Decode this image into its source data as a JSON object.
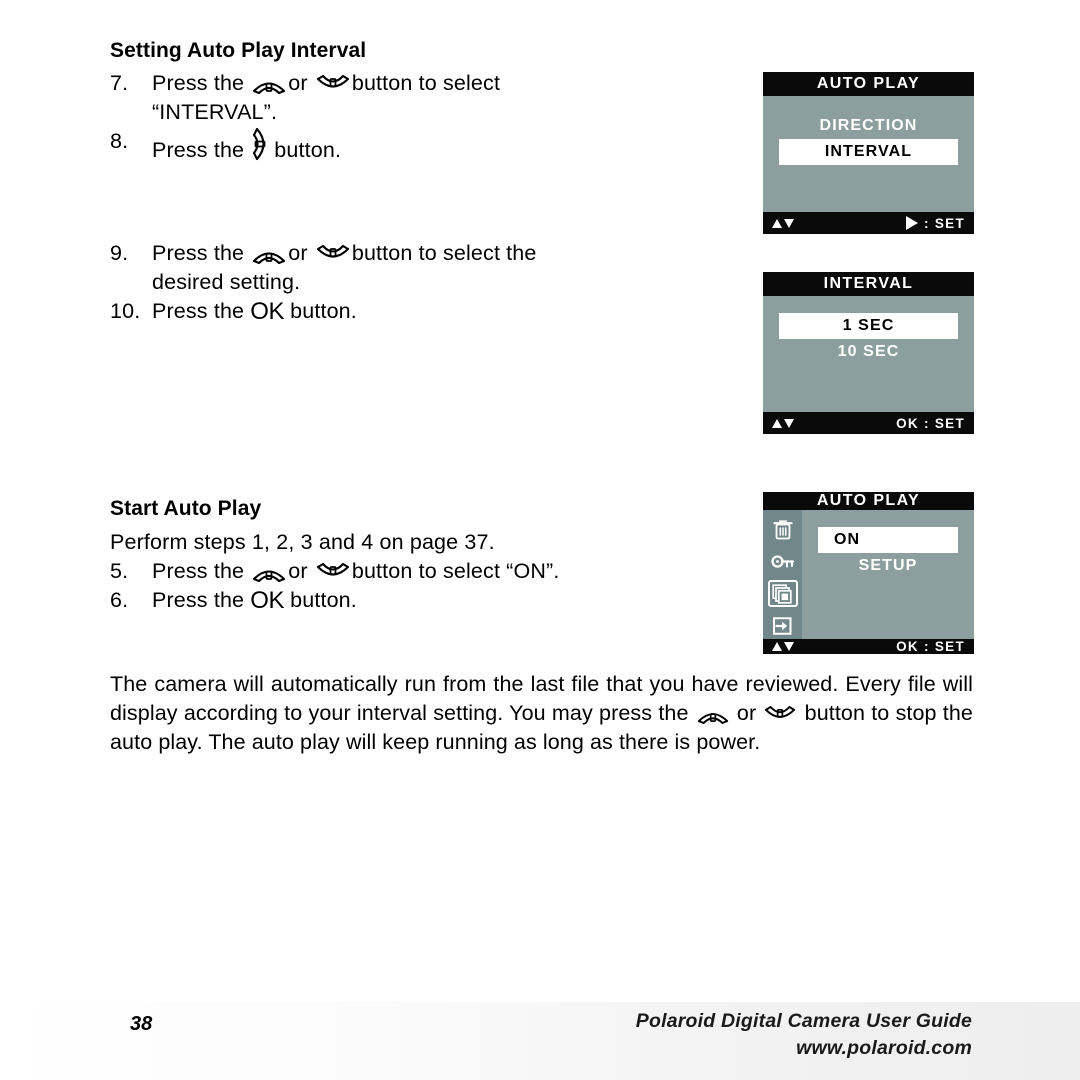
{
  "document": {
    "page_number": "38",
    "footer_title": "Polaroid Digital Camera User Guide",
    "footer_url": "www.polaroid.com"
  },
  "sections": [
    {
      "heading": "Setting Auto Play Interval",
      "steps": [
        {
          "number": "7.",
          "parts": [
            "Press the ",
            "[up-button-icon]",
            " or ",
            "[down-button-icon]",
            " button to select"
          ],
          "text_before_icons": "Press the",
          "text_between_icons": "or",
          "text_after_icons": "button to select",
          "continuation": "“INTERVAL”."
        },
        {
          "number": "8.",
          "text_before_icons": "Press the",
          "icon": "[right-button-icon]",
          "text_after_icons": "button."
        }
      ]
    },
    {
      "heading": "",
      "steps": [
        {
          "number": "9.",
          "text_before_icons": "Press the",
          "text_between_icons": "or",
          "text_after_icons": "button to select the",
          "continuation": "desired setting."
        },
        {
          "number": "10.",
          "text_before_icons": "Press the",
          "icon": "[ok-button-glyph]",
          "ok_label": "OK",
          "text_after_icons": "button."
        }
      ]
    },
    {
      "heading": "Start Auto Play",
      "intro": "Perform steps 1, 2, 3 and 4 on page 37.",
      "steps": [
        {
          "number": "5.",
          "text_before_icons": "Press the",
          "text_between_icons": "or",
          "text_after_icons": "button to select “ON”."
        },
        {
          "number": "6.",
          "text_before_icons": "Press the",
          "ok_label": "OK",
          "text_after_icons": "button."
        }
      ]
    }
  ],
  "body_paragraph": {
    "segment_1": "The camera will automatically run from the last file that you have reviewed. Every file will display according to your interval setting. You may press the",
    "segment_2": "or",
    "segment_3": "button to stop the auto play. The auto play will keep running as long as there is power."
  },
  "lcd_screens": [
    {
      "id": "auto-play-interval",
      "title": "AUTO PLAY",
      "has_sidebar": false,
      "options": [
        {
          "label": "DIRECTION",
          "highlighted": false
        },
        {
          "label": "INTERVAL",
          "highlighted": true
        }
      ],
      "footer_hint_icon": "right-triangle-icon",
      "footer_hint": ": SET"
    },
    {
      "id": "interval-values",
      "title": "INTERVAL",
      "has_sidebar": false,
      "options": [
        {
          "label": "1 SEC",
          "highlighted": true
        },
        {
          "label": "10 SEC",
          "highlighted": false
        }
      ],
      "footer_hint_icon": "",
      "footer_hint": "OK : SET"
    },
    {
      "id": "auto-play-on",
      "title": "AUTO PLAY",
      "has_sidebar": true,
      "sidebar_icons": [
        {
          "name": "trash-icon",
          "selected": false
        },
        {
          "name": "key-icon",
          "selected": false
        },
        {
          "name": "slideshow-frames-icon",
          "selected": true
        },
        {
          "name": "exit-arrow-icon",
          "selected": false
        }
      ],
      "options": [
        {
          "label": "ON",
          "highlighted": true
        },
        {
          "label": "SETUP",
          "highlighted": false
        }
      ],
      "footer_hint_icon": "",
      "footer_hint": "OK : SET"
    }
  ],
  "colors": {
    "lcd_body": "#8d9e9e",
    "lcd_sidebar": "#71878a",
    "lcd_bar": "#0a0a0a",
    "highlight_bg": "#ffffff",
    "text": "#000000"
  }
}
